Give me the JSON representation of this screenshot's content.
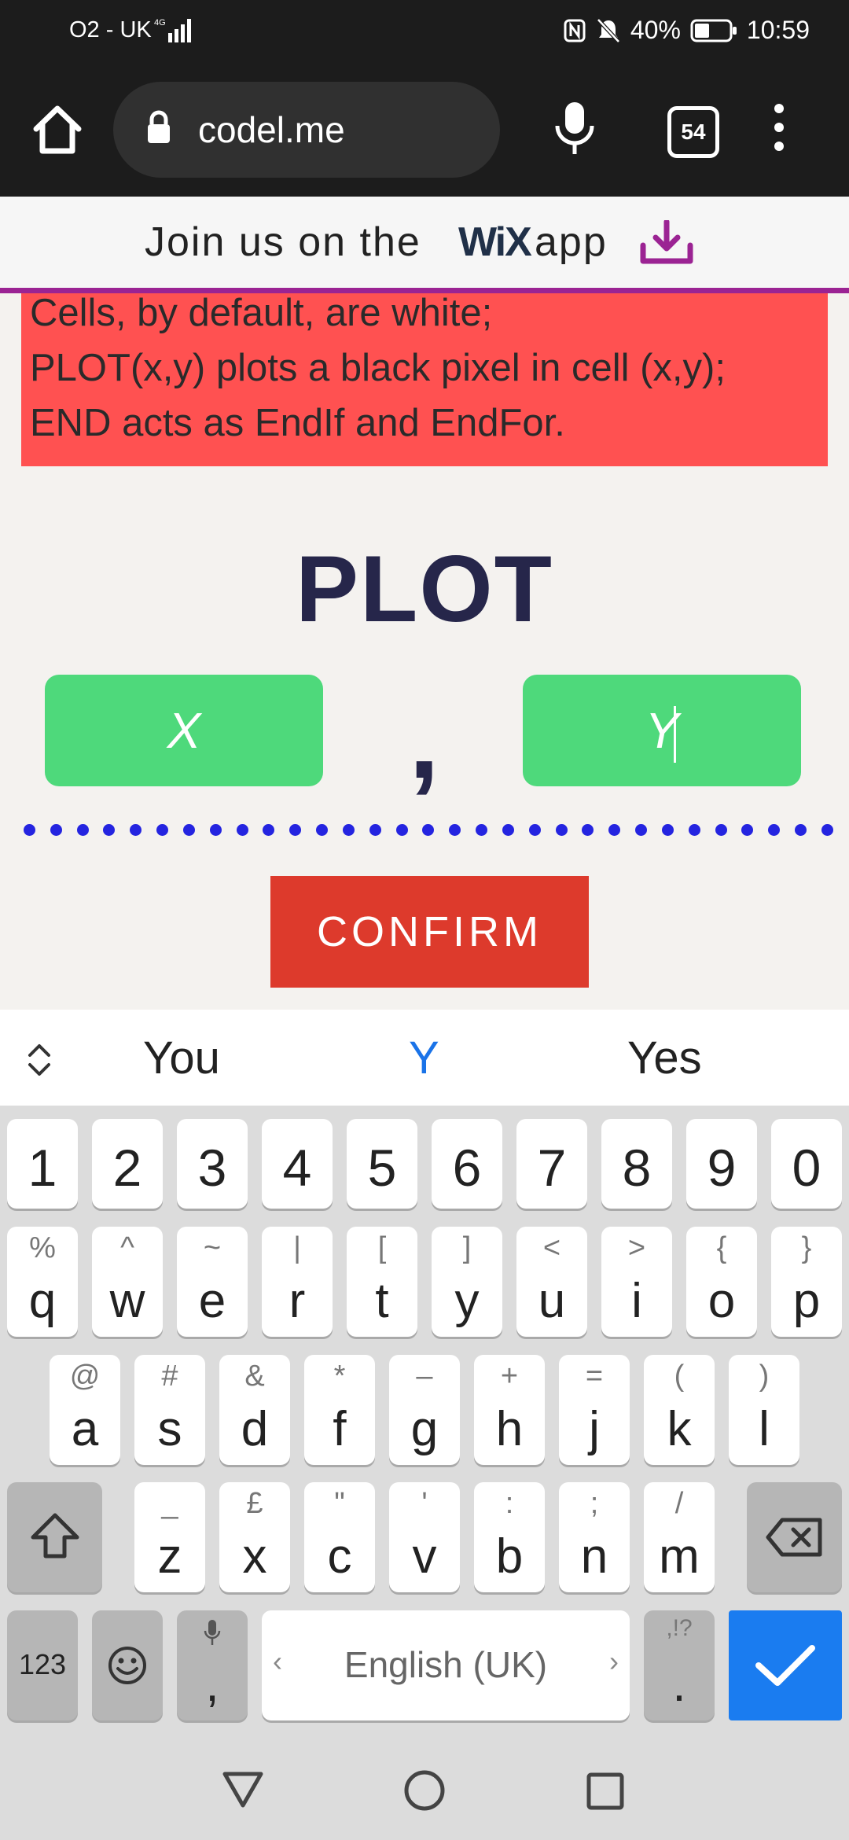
{
  "status": {
    "carrier": "O2 - UK",
    "network": "4G",
    "battery": "40%",
    "time": "10:59"
  },
  "browser": {
    "url": "codel.me",
    "tab_count": "54"
  },
  "banner": {
    "text": "Join us on the",
    "logo": "WiX",
    "app": "app"
  },
  "rules": [
    "Cells, by default, are white;",
    "PLOT(x,y) plots a black pixel in cell (x,y);",
    "END acts as EndIf and EndFor."
  ],
  "main": {
    "title": "PLOT",
    "x_value": "X",
    "y_value": "Y",
    "comma": ",",
    "confirm_label": "CONFIRM"
  },
  "suggestions": {
    "left": "You",
    "center": "Y",
    "right": "Yes",
    "center_color": "#1a73e8"
  },
  "keyboard": {
    "numbers": [
      "1",
      "2",
      "3",
      "4",
      "5",
      "6",
      "7",
      "8",
      "9",
      "0"
    ],
    "row1": [
      [
        "q",
        "%"
      ],
      [
        "w",
        "^"
      ],
      [
        "e",
        "~"
      ],
      [
        "r",
        "|"
      ],
      [
        "t",
        "["
      ],
      [
        "y",
        "]"
      ],
      [
        "u",
        "<"
      ],
      [
        "i",
        ">"
      ],
      [
        "o",
        "{"
      ],
      [
        "p",
        "}"
      ]
    ],
    "row2": [
      [
        "a",
        "@"
      ],
      [
        "s",
        "#"
      ],
      [
        "d",
        "&"
      ],
      [
        "f",
        "*"
      ],
      [
        "g",
        "–"
      ],
      [
        "h",
        "+"
      ],
      [
        "j",
        "="
      ],
      [
        "k",
        "("
      ],
      [
        "l",
        ")"
      ]
    ],
    "row3": [
      [
        "z",
        "_"
      ],
      [
        "x",
        "£"
      ],
      [
        "c",
        "\""
      ],
      [
        "v",
        "'"
      ],
      [
        "b",
        ":"
      ],
      [
        "n",
        ";"
      ],
      [
        "m",
        "/"
      ]
    ],
    "sym_label": "123",
    "comma_key": ",",
    "space_label": "English (UK)",
    "period_key": ".",
    "period_alt": ",!?",
    "enter_color": "#1a7cf0"
  },
  "colors": {
    "note_red": "#ff5151",
    "field_green": "#4ed97b",
    "confirm_red": "#dd3a2c",
    "title_navy": "#26264a",
    "dots_blue": "#2424e0"
  }
}
